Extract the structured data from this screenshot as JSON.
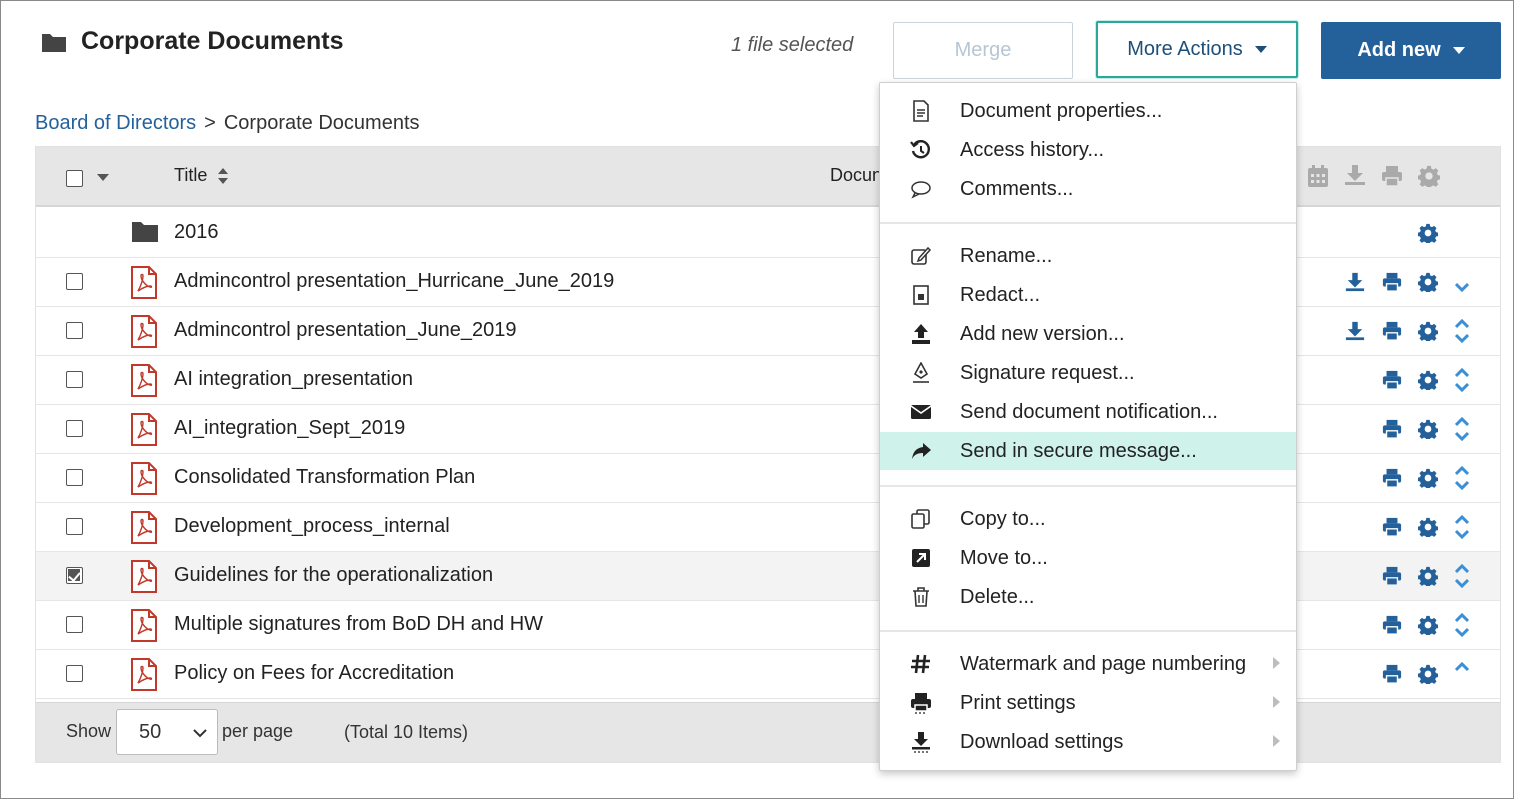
{
  "header": {
    "title": "Corporate Documents",
    "selected_count": "1 file selected",
    "merge_label": "Merge",
    "more_actions_label": "More Actions",
    "add_new_label": "Add new"
  },
  "breadcrumb": {
    "parent": "Board of Directors",
    "separator": ">",
    "current": "Corporate Documents"
  },
  "table": {
    "columns": {
      "title": "Title",
      "document": "Docun"
    },
    "rows": [
      {
        "title": "2016",
        "type": "folder",
        "checked": false
      },
      {
        "title": "Admincontrol presentation_Hurricane_June_2019",
        "type": "pdf",
        "checked": false
      },
      {
        "title": "Admincontrol presentation_June_2019",
        "type": "pdf",
        "checked": false
      },
      {
        "title": "AI integration_presentation",
        "type": "pdf",
        "checked": false
      },
      {
        "title": "AI_integration_Sept_2019",
        "type": "pdf",
        "checked": false
      },
      {
        "title": "Consolidated Transformation Plan",
        "type": "pdf",
        "checked": false
      },
      {
        "title": "Development_process_internal",
        "type": "pdf",
        "checked": false
      },
      {
        "title": "Guidelines for the operationalization",
        "type": "pdf",
        "checked": true
      },
      {
        "title": "Multiple signatures from BoD DH and HW",
        "type": "pdf",
        "checked": false
      },
      {
        "title": "Policy on Fees for Accreditation",
        "type": "pdf",
        "checked": false
      }
    ],
    "footer": {
      "show_label": "Show",
      "per_page_value": "50",
      "per_page_label": "per page",
      "total": "(Total 10 Items)"
    }
  },
  "menu": {
    "items": [
      {
        "label": "Document properties...",
        "icon": "document-icon"
      },
      {
        "label": "Access history...",
        "icon": "history-icon"
      },
      {
        "label": "Comments...",
        "icon": "comment-icon"
      },
      {
        "label": "Rename...",
        "icon": "edit-icon"
      },
      {
        "label": "Redact...",
        "icon": "redact-icon"
      },
      {
        "label": "Add new version...",
        "icon": "upload-icon"
      },
      {
        "label": "Signature request...",
        "icon": "signature-pen-icon"
      },
      {
        "label": "Send document notification...",
        "icon": "envelope-icon"
      },
      {
        "label": "Send in secure message...",
        "icon": "share-arrow-icon",
        "highlighted": true
      },
      {
        "label": "Copy to...",
        "icon": "copy-icon"
      },
      {
        "label": "Move to...",
        "icon": "move-icon"
      },
      {
        "label": "Delete...",
        "icon": "trash-icon"
      },
      {
        "label": "Watermark and page numbering",
        "icon": "hash-icon",
        "submenu": true
      },
      {
        "label": "Print settings",
        "icon": "printer-icon",
        "submenu": true
      },
      {
        "label": "Download settings",
        "icon": "download-icon",
        "submenu": true
      }
    ]
  },
  "colors": {
    "primary": "#24619b",
    "highlight": "#cff2ea",
    "pdf_red": "#c0392b",
    "header_bg": "#e6e6e6"
  }
}
